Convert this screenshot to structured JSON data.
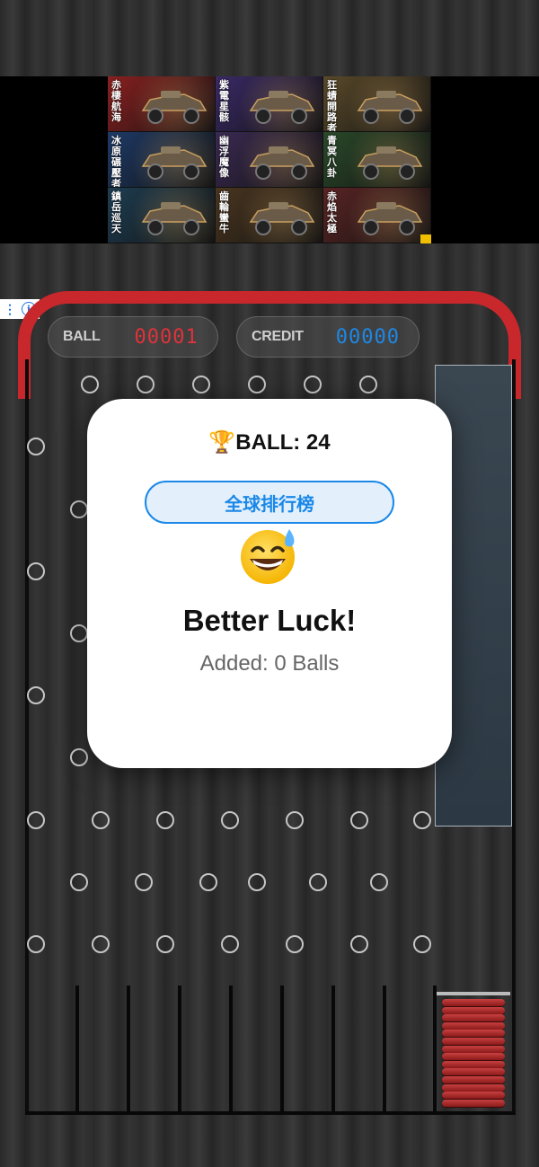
{
  "ad": {
    "tiles": [
      {
        "label": "赤棲航海",
        "bg": "#8a2020"
      },
      {
        "label": "紫電星骸",
        "bg": "#3a2a66"
      },
      {
        "label": "狂蜻開路者",
        "bg": "#5a4a2a"
      },
      {
        "label": "冰原碾壓者",
        "bg": "#1e3a66"
      },
      {
        "label": "幽浮魔像",
        "bg": "#3a2a52"
      },
      {
        "label": "青冥八卦",
        "bg": "#2a4a2a"
      },
      {
        "label": "鎮岳巡天",
        "bg": "#1e3e52"
      },
      {
        "label": "齒輪蠻牛",
        "bg": "#4a3620"
      },
      {
        "label": "赤焰太極",
        "bg": "#5a2424"
      }
    ],
    "info_icon": "info-icon",
    "menu_icon": "kebab-menu-icon"
  },
  "hud": {
    "ball_label": "BALL",
    "ball_value": "00001",
    "ball_color": "#e0323a",
    "credit_label": "CREDIT",
    "credit_value": "00000",
    "credit_color": "#1e88e5"
  },
  "board": {
    "frame_color": "#c8282c",
    "peg_icon": "peg-circle",
    "spring_icon": "plunger-spring"
  },
  "modal": {
    "trophy_icon": "trophy-icon",
    "trophy_glyph": "🏆",
    "ball_text": "BALL: 24",
    "rank_button": "全球排行榜",
    "emoji_icon": "grinning-sweat-emoji-icon",
    "result_title": "Better Luck!",
    "result_sub": "Added: 0 Balls"
  }
}
